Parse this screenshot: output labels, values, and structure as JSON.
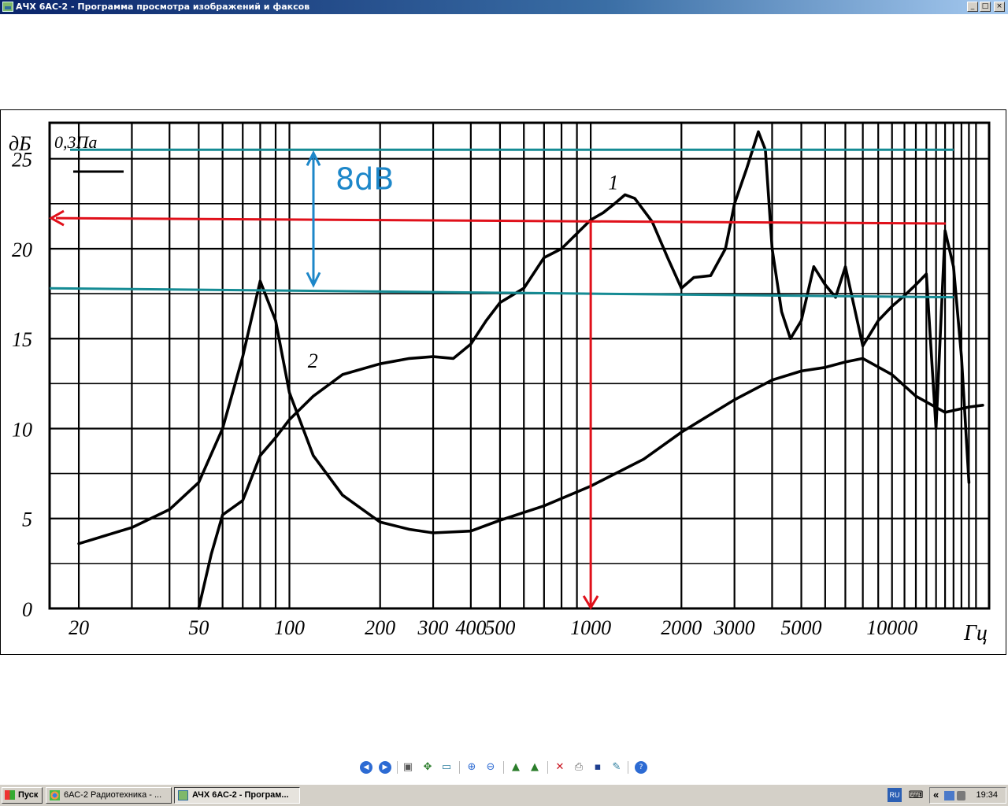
{
  "window": {
    "title": "АЧХ 6АС-2 - Программа просмотра изображений и факсов",
    "controls": {
      "minimize": "_",
      "maximize": "□",
      "close": "×"
    }
  },
  "image": {
    "ylabel": "дБ",
    "note_top_left": "0,3Па",
    "curve1_label": "1",
    "curve2_label": "2",
    "span_annotation": "8dB",
    "xunit": "Гц",
    "annotation_colors": {
      "teal": "#158b94",
      "red": "#e0101a",
      "blue": "#1d87c9"
    }
  },
  "chart_data": {
    "type": "line",
    "xscale": "log",
    "xlabel": "Гц",
    "ylabel": "дБ",
    "ylim": [
      0,
      27
    ],
    "xlim": [
      16,
      21000
    ],
    "grid": true,
    "xticks": [
      20,
      50,
      100,
      200,
      300,
      400,
      500,
      1000,
      2000,
      3000,
      5000,
      10000
    ],
    "xtick_labels": [
      "20",
      "50",
      "100",
      "200",
      "300",
      "400",
      "500",
      "1000",
      "2000",
      "3000",
      "5000",
      "10000"
    ],
    "yticks": [
      0,
      5,
      10,
      15,
      20,
      25
    ],
    "ytick_labels": [
      "0",
      "5",
      "10",
      "15",
      "20",
      "25"
    ],
    "series": [
      {
        "name": "1",
        "x": [
          50,
          55,
          60,
          70,
          80,
          90,
          100,
          120,
          150,
          200,
          250,
          300,
          350,
          400,
          450,
          500,
          600,
          700,
          800,
          1000,
          1100,
          1200,
          1300,
          1400,
          1600,
          1800,
          2000,
          2200,
          2500,
          2800,
          3000,
          3300,
          3600,
          3800,
          4000,
          4300,
          4600,
          5000,
          5500,
          6000,
          6500,
          7000,
          8000,
          9000,
          10000,
          11000,
          12000,
          13000,
          14000,
          15000,
          16000,
          17000,
          18000
        ],
        "y": [
          0,
          3,
          5.2,
          6,
          8.5,
          9.5,
          10.5,
          11.8,
          13,
          13.6,
          13.9,
          14,
          13.9,
          14.7,
          16,
          17,
          17.8,
          19.5,
          20,
          21.6,
          22,
          22.5,
          23,
          22.8,
          21.5,
          19.5,
          17.8,
          18.4,
          18.5,
          20,
          22.5,
          24.5,
          26.5,
          25.5,
          20,
          16.5,
          15,
          16,
          19,
          18,
          17.3,
          19,
          14.6,
          16,
          16.8,
          17.4,
          18,
          18.6,
          10,
          21,
          19,
          14,
          7
        ]
      },
      {
        "name": "2",
        "x": [
          20,
          30,
          40,
          50,
          60,
          70,
          80,
          90,
          100,
          120,
          150,
          200,
          250,
          300,
          400,
          500,
          700,
          1000,
          1500,
          2000,
          3000,
          4000,
          5000,
          6000,
          7000,
          8000,
          10000,
          12000,
          15000,
          18000,
          20000
        ],
        "y": [
          3.6,
          4.5,
          5.5,
          7,
          10,
          14,
          18.2,
          16,
          12,
          8.5,
          6.3,
          4.8,
          4.4,
          4.2,
          4.3,
          4.9,
          5.7,
          6.8,
          8.3,
          9.8,
          11.6,
          12.7,
          13.2,
          13.4,
          13.7,
          13.9,
          13,
          11.8,
          10.9,
          11.2,
          11.3
        ]
      }
    ],
    "annotations": [
      {
        "type": "hline",
        "y": 25.5,
        "color": "#158b94"
      },
      {
        "type": "hline",
        "y": 17.8,
        "color": "#158b94"
      },
      {
        "type": "hline",
        "y": 21.5,
        "color": "#e0101a"
      },
      {
        "type": "vline",
        "x": 1000,
        "color": "#e0101a"
      },
      {
        "type": "span",
        "text": "8dB",
        "from": 17.8,
        "to": 25.5,
        "color": "#1d87c9"
      }
    ]
  },
  "toolbar": {
    "buttons": [
      {
        "name": "previous-image-button",
        "glyph": "◀"
      },
      {
        "name": "next-image-button",
        "glyph": "▶"
      },
      {
        "name": "best-fit-button",
        "glyph": "▣"
      },
      {
        "name": "actual-size-button",
        "glyph": "✥"
      },
      {
        "name": "slideshow-button",
        "glyph": "▭"
      },
      {
        "name": "zoom-in-button",
        "glyph": "⊕"
      },
      {
        "name": "zoom-out-button",
        "glyph": "⊖"
      },
      {
        "name": "rotate-clockwise-button",
        "glyph": "▲"
      },
      {
        "name": "rotate-counterclockwise-button",
        "glyph": "▲"
      },
      {
        "name": "delete-button",
        "glyph": "✕"
      },
      {
        "name": "print-button",
        "glyph": "⎙"
      },
      {
        "name": "save-button",
        "glyph": "▪"
      },
      {
        "name": "open-for-editing-button",
        "glyph": "✎"
      },
      {
        "name": "help-button",
        "glyph": "?"
      }
    ]
  },
  "taskbar": {
    "start_label": "Пуск",
    "tasks": [
      {
        "label": "6АС-2 Радиотехника - ...",
        "active": false
      },
      {
        "label": "АЧХ 6АС-2 - Програм...",
        "active": true
      }
    ],
    "language": "RU",
    "tray_expand": "«",
    "clock": "19:34"
  }
}
